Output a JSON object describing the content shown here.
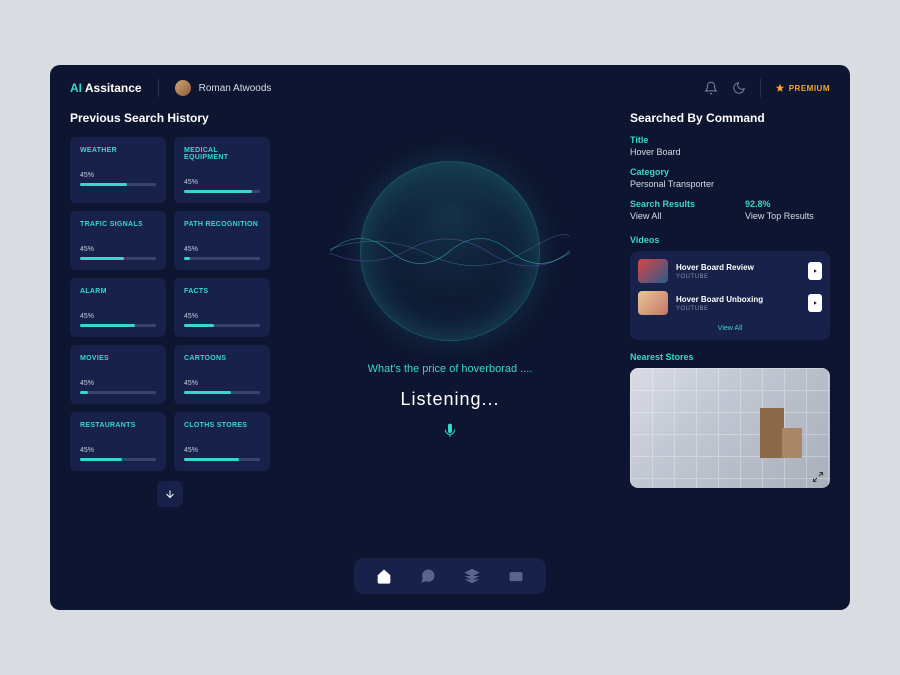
{
  "brand": {
    "ai": "AI",
    "rest": " Assitance"
  },
  "user": {
    "name": "Roman Atwoods"
  },
  "premium": {
    "label": "PREMIUM"
  },
  "history": {
    "title": "Previous Search History",
    "items": [
      {
        "label": "WEATHER",
        "pct": "45%",
        "fill": 62
      },
      {
        "label": "MEDICAL EQUIPMENT",
        "pct": "45%",
        "fill": 90
      },
      {
        "label": "TRAFIC SIGNALS",
        "pct": "45%",
        "fill": 58
      },
      {
        "label": "PATH RECOGNITION",
        "pct": "45%",
        "fill": 8
      },
      {
        "label": "ALARM",
        "pct": "45%",
        "fill": 72
      },
      {
        "label": "FACTS",
        "pct": "45%",
        "fill": 40
      },
      {
        "label": "MOVIES",
        "pct": "45%",
        "fill": 10
      },
      {
        "label": "CARTOONS",
        "pct": "45%",
        "fill": 62
      },
      {
        "label": "RESTAURANTS",
        "pct": "45%",
        "fill": 55
      },
      {
        "label": "CLOTHS STORES",
        "pct": "45%",
        "fill": 72
      }
    ]
  },
  "center": {
    "query": "What's the price of hoverborad ....",
    "status": "Listening..."
  },
  "searched": {
    "title": "Searched By Command",
    "title_label": "Title",
    "title_value": "Hover Board",
    "category_label": "Category",
    "category_value": "Personal Transporter",
    "results_label": "Search Results",
    "results_value": "View All",
    "accuracy_label": "92.8%",
    "accuracy_value": "View Top Results"
  },
  "videos": {
    "label": "Videos",
    "items": [
      {
        "title": "Hover Board Review",
        "source": "YOUTUBE"
      },
      {
        "title": "Hover Board Unboxing",
        "source": "YOUTUBE"
      }
    ],
    "view_all": "View All"
  },
  "stores": {
    "label": "Nearest Stores"
  }
}
